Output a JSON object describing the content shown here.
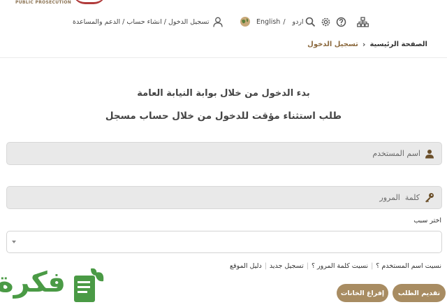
{
  "header": {
    "org_name": "PUBLIC PROSECUTION",
    "nav_text": "تسجيل الدخول  / انشاء حساب / الدعم والمساعدة",
    "lang_urdu": "اردو",
    "lang_sep": "/",
    "lang_english": "English"
  },
  "breadcrumb": {
    "home": "الصفحة الرئيسية",
    "current": "تسجيل الدخول"
  },
  "main": {
    "heading": "بدء الدخول من خلال بوابة النيابة العامة",
    "subheading": "طلب استثناء مؤقت للدخول من خلال حساب مسجل"
  },
  "form": {
    "username_placeholder": "اسم المستخدم",
    "password_placeholder": "كلمة  المرور",
    "reason_label": "اختر سبب",
    "reason_value": ""
  },
  "links": {
    "forgot_username": "نسيت اسم المستخدم ؟",
    "forgot_password": "نسيت كلمة المرور ؟",
    "register": "تسجيل جديد",
    "guide": "دليل الموقع"
  },
  "buttons": {
    "submit": "تقديم الطلب",
    "clear": "إفراغ الخانات"
  },
  "watermark": {
    "text": "فكرة"
  },
  "colors": {
    "accent": "#a88c62",
    "breadcrumb_current": "#8c6a3f",
    "watermark": "#4a9a45"
  }
}
